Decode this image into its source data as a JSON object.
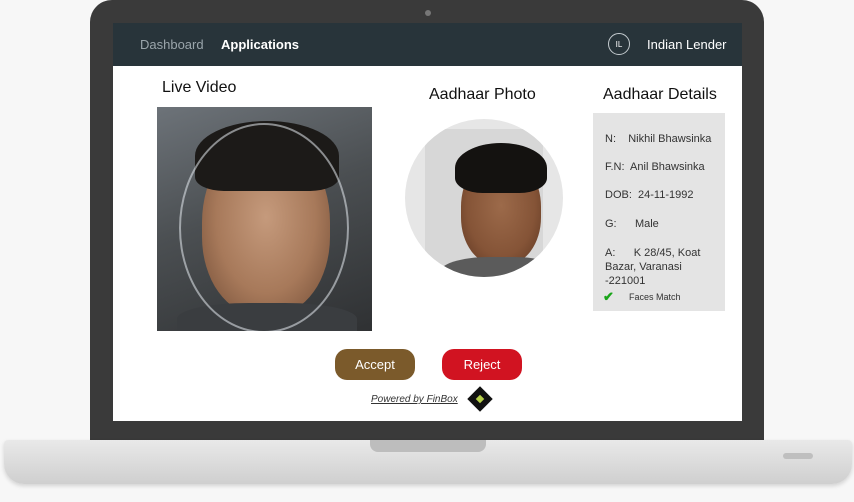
{
  "nav": {
    "links": [
      "Dashboard",
      "Applications"
    ],
    "avatar_initials": "IL",
    "user_name": "Indian Lender"
  },
  "live_video": {
    "title": "Live Video"
  },
  "aadhaar_photo": {
    "title": "Aadhaar Photo"
  },
  "aadhaar_details": {
    "title": "Aadhaar Details",
    "name": "N:    Nikhil Bhawsinka",
    "father_name": "F.N:  Anil Bhawsinka",
    "dob": "DOB:  24-11-1992",
    "gender": "G:      Male",
    "address_line1": "A:      K 28/45, Koat",
    "address_line2": "Bazar, Varanasi",
    "address_line3": "-221001",
    "match_icon": "check-icon",
    "match_text": "Faces Match",
    "match_color": "#1aa51a"
  },
  "actions": {
    "accept_label": "Accept",
    "reject_label": "Reject",
    "accept_color": "#7b5a2b",
    "reject_color": "#d11321"
  },
  "footer": {
    "powered_by": "Powered by FinBox",
    "logo_icon": "finbox-logo-icon"
  }
}
